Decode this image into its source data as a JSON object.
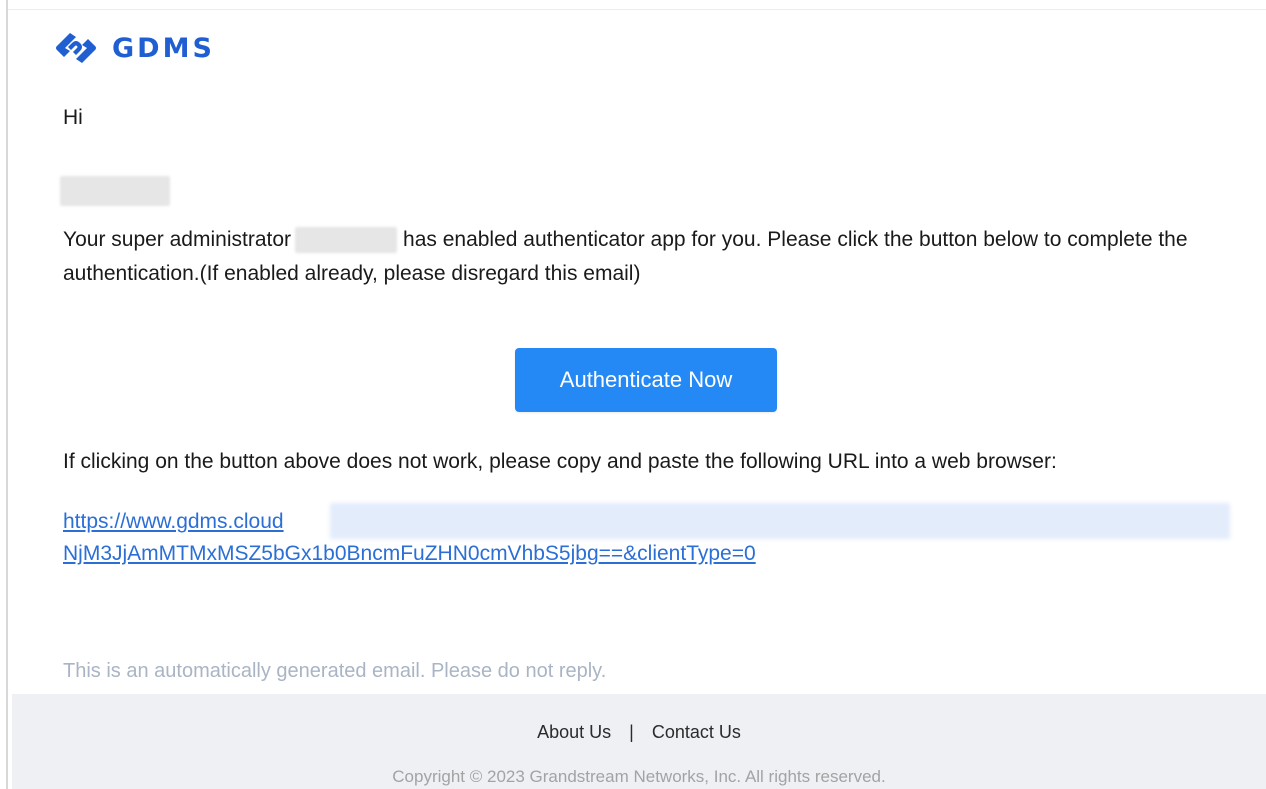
{
  "brand": {
    "name": "GDMS",
    "logo_icon": "gdms-logo-icon",
    "color": "#1f5fd1"
  },
  "email": {
    "greeting": "Hi",
    "body_part1": "Your super administrator",
    "body_part2": "has enabled authenticator app for you. Please click the button below to complete the authentication.(If enabled already, please disregard this email)",
    "cta_label": "Authenticate Now",
    "cta_color": "#2589f5",
    "fallback_text": "If clicking on the button above does not work, please copy and paste the following URL into a web browser:",
    "url_line1": "https://www.gdms.cloud",
    "url_line2": "NjM3JjAmMTMxMSZ5bGx1b0BncmFuZHN0cmVhbS5jbg==&clientType=0",
    "link_color": "#2b6fd6",
    "auto_note": "This is an automatically generated email. Please do not reply."
  },
  "footer": {
    "about_label": "About Us",
    "separator": "|",
    "contact_label": "Contact Us",
    "copyright": "Copyright © 2023 Grandstream Networks, Inc. All rights reserved."
  }
}
